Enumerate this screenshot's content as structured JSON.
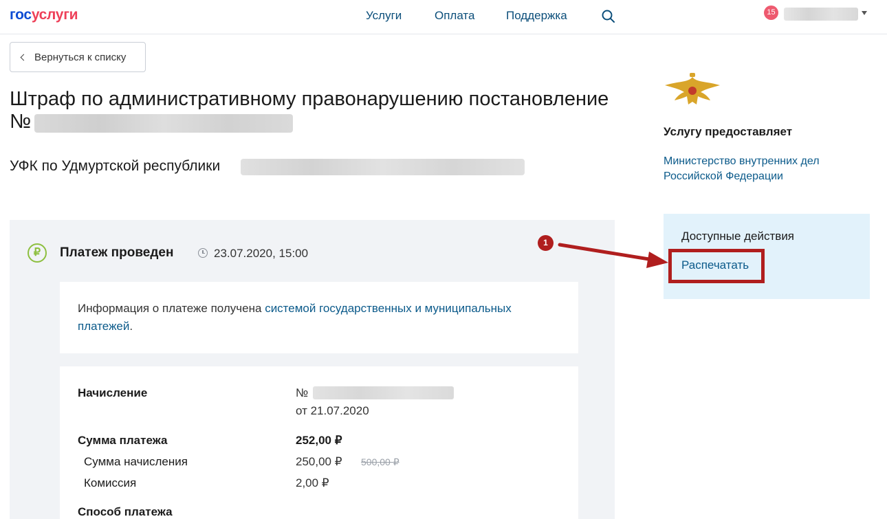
{
  "header": {
    "logo_part1": "гос",
    "logo_part2": "услуги",
    "nav": [
      "Услуги",
      "Оплата",
      "Поддержка"
    ],
    "notification_count": "15",
    "icons": {
      "search": "search-icon",
      "user_menu": "chevron-down-icon"
    }
  },
  "back_label": "Вернуться к списку",
  "title_line1": "Штраф по административному правонарушению постановление",
  "title_line2": "№",
  "subtitle": "УФК по Удмуртской республики",
  "payment": {
    "status": "Платеж проведен",
    "datetime": "23.07.2020, 15:00",
    "currency_symbol": "₽",
    "info_text": "Информация о платеже получена ",
    "info_link": "системой государственных и муниципальных платежей",
    "info_tail": ".",
    "accrual_label": "Начисление",
    "accrual_number_prefix": "№",
    "accrual_date": "от 21.07.2020",
    "total_label": "Сумма платежа",
    "total_value": "252,00 ₽",
    "accrual_sum_label": "Сумма начисления",
    "accrual_sum_value": "250,00 ₽",
    "accrual_sum_old": "500,00 ₽",
    "commission_label": "Комиссия",
    "commission_value": "2,00 ₽",
    "method_label": "Способ платежа"
  },
  "sidebar": {
    "provider_label": "Услугу предоставляет",
    "provider_name": "Министерство внутренних дел Российской Федерации",
    "actions_title": "Доступные действия",
    "print_label": "Распечатать"
  },
  "annotation": {
    "step": "1"
  },
  "colors": {
    "link": "#0b5a8a",
    "nav": "#0b4e7a",
    "highlight": "#b01e1e",
    "success": "#8dbf3f",
    "actions_bg": "#e2f2fb"
  }
}
